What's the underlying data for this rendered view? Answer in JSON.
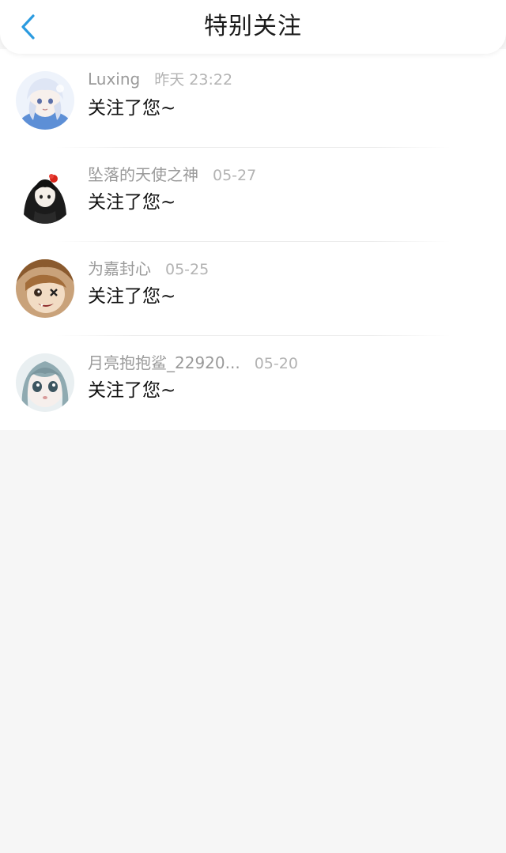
{
  "header": {
    "title": "特别关注",
    "back_icon": "chevron-left-icon",
    "accent_color": "#2b9be0"
  },
  "list": {
    "items": [
      {
        "name": "Luxing",
        "time": "昨天 23:22",
        "message": "关注了您~",
        "avatar": "anime-avatar-white-hair-icon"
      },
      {
        "name": "坠落的天使之神",
        "time": "05-27",
        "message": "关注了您~",
        "avatar": "anime-avatar-black-hair-icon"
      },
      {
        "name": "为嘉封心",
        "time": "05-25",
        "message": "关注了您~",
        "avatar": "anime-avatar-brown-hair-icon"
      },
      {
        "name": "月亮抱抱鲨_22920...",
        "time": "05-20",
        "message": "关注了您~",
        "avatar": "anime-avatar-teal-hair-icon"
      }
    ]
  }
}
